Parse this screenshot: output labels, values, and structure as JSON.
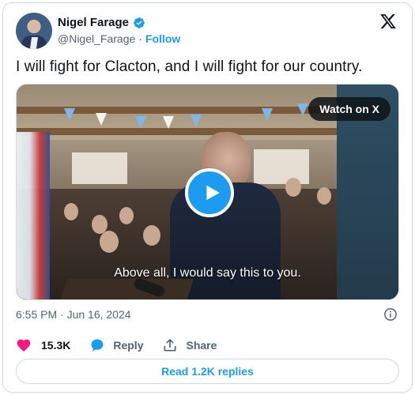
{
  "author": {
    "display_name": "Nigel Farage",
    "handle": "@Nigel_Farage",
    "separator": "·",
    "follow_label": "Follow"
  },
  "tweet": {
    "text": "I will fight for Clacton, and I will fight for our country."
  },
  "media": {
    "watch_label": "Watch on X",
    "caption": "Above all, I would say this to you."
  },
  "meta": {
    "timestamp": "6:55 PM · Jun 16, 2024"
  },
  "actions": {
    "likes_count": "15.3K",
    "reply_label": "Reply",
    "share_label": "Share"
  },
  "footer": {
    "read_replies_label": "Read 1.2K replies"
  },
  "colors": {
    "accent": "#1d9bf0",
    "like": "#f91880",
    "text": "#0f1419",
    "muted": "#536471"
  },
  "icons": [
    "verified-badge-icon",
    "x-logo-icon",
    "play-icon",
    "info-icon",
    "heart-icon",
    "reply-bubble-icon",
    "share-icon"
  ]
}
